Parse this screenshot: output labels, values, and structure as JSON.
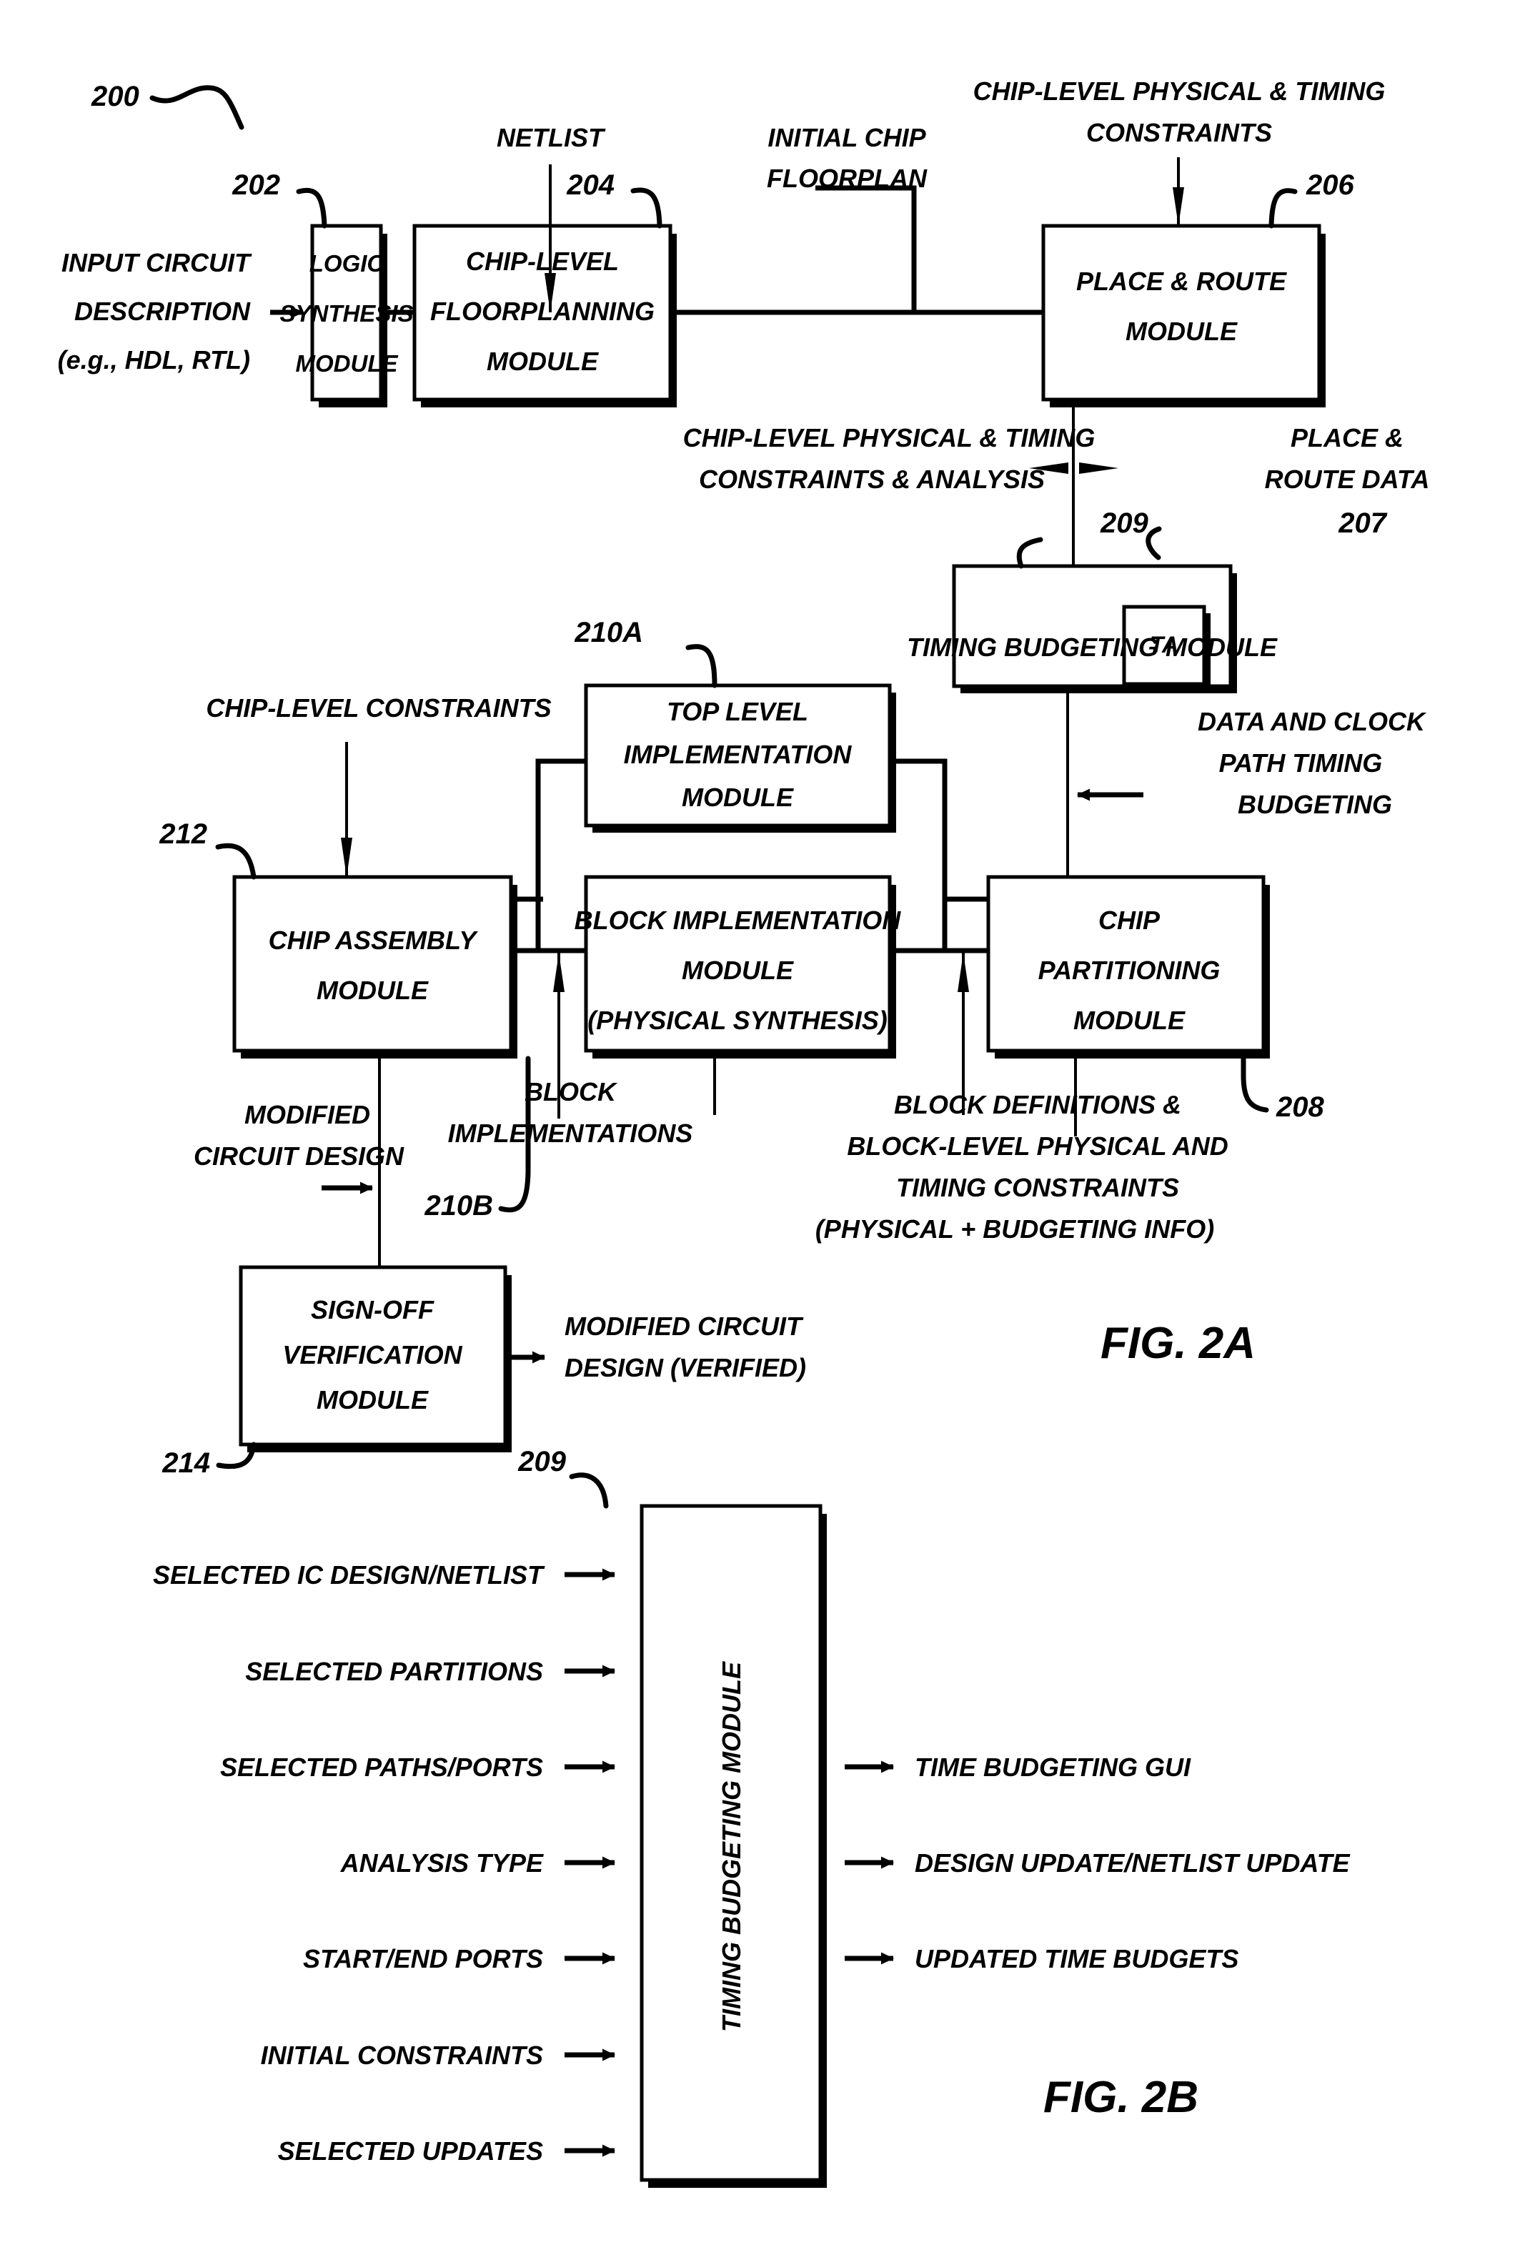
{
  "figure_2a": {
    "ref_main": "200",
    "fig_label": "FIG. 2A",
    "boxes": {
      "logic_synthesis": {
        "ref": "202",
        "lines": [
          "LOGIC",
          "SYNTHESIS",
          "MODULE"
        ]
      },
      "chip_level_floorplanning": {
        "ref": "204",
        "lines": [
          "CHIP-LEVEL",
          "FLOORPLANNING",
          "MODULE"
        ]
      },
      "place_and_route": {
        "ref": "206",
        "lines": [
          "PLACE & ROUTE",
          "MODULE"
        ]
      },
      "timing_budgeting": {
        "ref": "209",
        "lines": [
          "TIMING BUDGETING MODULE"
        ],
        "inner_badge": {
          "ref": "207",
          "label": "TA"
        }
      },
      "top_level_implementation": {
        "ref": "210A",
        "lines": [
          "TOP LEVEL",
          "IMPLEMENTATION",
          "MODULE"
        ]
      },
      "chip_assembly": {
        "ref": "212",
        "lines": [
          "CHIP ASSEMBLY",
          "MODULE"
        ]
      },
      "block_implementation": {
        "ref": "210B",
        "lines": [
          "BLOCK IMPLEMENTATION",
          "MODULE",
          "(PHYSICAL SYNTHESIS)"
        ]
      },
      "chip_partitioning": {
        "ref": "208",
        "lines": [
          "CHIP",
          "PARTITIONING",
          "MODULE"
        ]
      },
      "sign_off_verification": {
        "ref": "214",
        "lines": [
          "SIGN-OFF",
          "VERIFICATION",
          "MODULE"
        ]
      }
    },
    "labels": {
      "input_circuit_description": [
        "INPUT CIRCUIT",
        "DESCRIPTION",
        "(e.g., HDL, RTL)"
      ],
      "netlist": [
        "NETLIST"
      ],
      "initial_chip_floorplan": [
        "INITIAL CHIP",
        "FLOORPLAN"
      ],
      "chip_level_physical_timing_constraints": [
        "CHIP-LEVEL PHYSICAL & TIMING",
        "CONSTRAINTS"
      ],
      "chip_level_constraints_analysis": [
        "CHIP-LEVEL PHYSICAL & TIMING",
        "CONSTRAINTS & ANALYSIS"
      ],
      "place_route_data": [
        "PLACE &",
        "ROUTE DATA"
      ],
      "chip_level_constraints": [
        "CHIP-LEVEL CONSTRAINTS"
      ],
      "data_and_clock_path_timing_budgeting": [
        "DATA AND CLOCK",
        "PATH TIMING",
        "BUDGETING"
      ],
      "modified_circuit_design": [
        "MODIFIED",
        "CIRCUIT DESIGN"
      ],
      "block_implementations": [
        "BLOCK",
        "IMPLEMENTATIONS"
      ],
      "block_definitions": [
        "BLOCK DEFINITIONS &",
        "BLOCK-LEVEL PHYSICAL AND",
        "TIMING CONSTRAINTS",
        "(PHYSICAL + BUDGETING INFO)"
      ],
      "modified_circuit_design_verified": [
        "MODIFIED CIRCUIT",
        "DESIGN (VERIFIED)"
      ]
    }
  },
  "figure_2b": {
    "ref": "209",
    "fig_label": "FIG. 2B",
    "module_label": "TIMING BUDGETING MODULE",
    "inputs": [
      "SELECTED IC DESIGN/NETLIST",
      "SELECTED PARTITIONS",
      "SELECTED PATHS/PORTS",
      "ANALYSIS TYPE",
      "START/END PORTS",
      "INITIAL CONSTRAINTS",
      "SELECTED UPDATES"
    ],
    "outputs": [
      "TIME BUDGETING GUI",
      "DESIGN UPDATE/NETLIST UPDATE",
      "UPDATED TIME BUDGETS"
    ]
  },
  "colors": {
    "ink": "#000000",
    "paper": "#ffffff"
  }
}
